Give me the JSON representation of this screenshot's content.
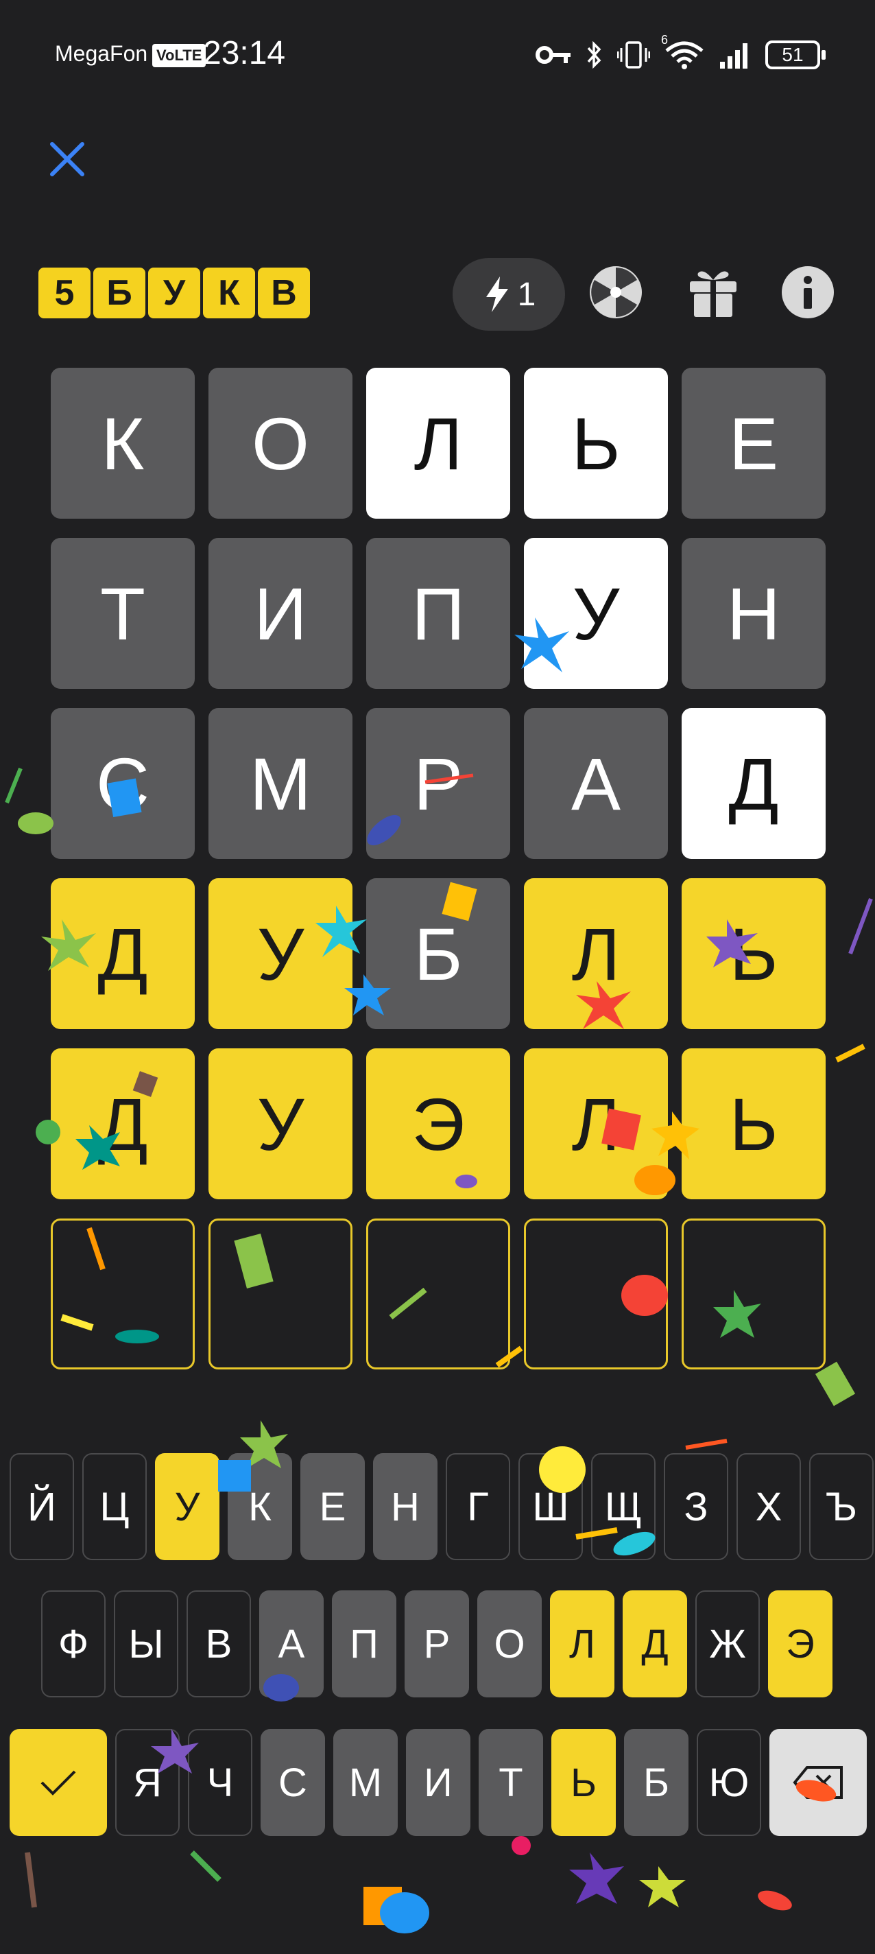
{
  "status_bar": {
    "carrier": "MegaFon",
    "volte": "VoLTE",
    "time": "23:14",
    "battery": "51",
    "network_sup": "6"
  },
  "header": {
    "word_length_badge": [
      "5",
      "Б",
      "У",
      "К",
      "В"
    ],
    "hint_count": "1",
    "icons": [
      "close-icon",
      "lightning-icon",
      "wheel-icon",
      "gift-icon",
      "info-icon"
    ]
  },
  "board": {
    "rows": [
      [
        {
          "l": "К",
          "s": "gray"
        },
        {
          "l": "О",
          "s": "gray"
        },
        {
          "l": "Л",
          "s": "white"
        },
        {
          "l": "Ь",
          "s": "white"
        },
        {
          "l": "Е",
          "s": "gray"
        }
      ],
      [
        {
          "l": "Т",
          "s": "gray"
        },
        {
          "l": "И",
          "s": "gray"
        },
        {
          "l": "П",
          "s": "gray"
        },
        {
          "l": "У",
          "s": "white"
        },
        {
          "l": "Н",
          "s": "gray"
        }
      ],
      [
        {
          "l": "С",
          "s": "gray"
        },
        {
          "l": "М",
          "s": "gray"
        },
        {
          "l": "Р",
          "s": "gray"
        },
        {
          "l": "А",
          "s": "gray"
        },
        {
          "l": "Д",
          "s": "white"
        }
      ],
      [
        {
          "l": "Д",
          "s": "yellow"
        },
        {
          "l": "У",
          "s": "yellow"
        },
        {
          "l": "Б",
          "s": "gray"
        },
        {
          "l": "Л",
          "s": "yellow"
        },
        {
          "l": "Ь",
          "s": "yellow"
        }
      ],
      [
        {
          "l": "Д",
          "s": "yellow"
        },
        {
          "l": "У",
          "s": "yellow"
        },
        {
          "l": "Э",
          "s": "yellow"
        },
        {
          "l": "Л",
          "s": "yellow"
        },
        {
          "l": "Ь",
          "s": "yellow"
        }
      ],
      [
        {
          "l": "",
          "s": "empty"
        },
        {
          "l": "",
          "s": "empty"
        },
        {
          "l": "",
          "s": "empty"
        },
        {
          "l": "",
          "s": "empty"
        },
        {
          "l": "",
          "s": "empty"
        }
      ]
    ]
  },
  "keyboard": {
    "row1": [
      {
        "k": "Й",
        "s": 0
      },
      {
        "k": "Ц",
        "s": 0
      },
      {
        "k": "У",
        "s": 2
      },
      {
        "k": "К",
        "s": 1
      },
      {
        "k": "Е",
        "s": 1
      },
      {
        "k": "Н",
        "s": 1
      },
      {
        "k": "Г",
        "s": 0
      },
      {
        "k": "Ш",
        "s": 0
      },
      {
        "k": "Щ",
        "s": 0
      },
      {
        "k": "З",
        "s": 0
      },
      {
        "k": "Х",
        "s": 0
      },
      {
        "k": "Ъ",
        "s": 0
      }
    ],
    "row2": [
      {
        "k": "Ф",
        "s": 0
      },
      {
        "k": "Ы",
        "s": 0
      },
      {
        "k": "В",
        "s": 0
      },
      {
        "k": "А",
        "s": 1
      },
      {
        "k": "П",
        "s": 1
      },
      {
        "k": "Р",
        "s": 1
      },
      {
        "k": "О",
        "s": 1
      },
      {
        "k": "Л",
        "s": 2
      },
      {
        "k": "Д",
        "s": 2
      },
      {
        "k": "Ж",
        "s": 0
      },
      {
        "k": "Э",
        "s": 2
      }
    ],
    "row3": [
      {
        "k": "Я",
        "s": 0
      },
      {
        "k": "Ч",
        "s": 0
      },
      {
        "k": "С",
        "s": 1
      },
      {
        "k": "М",
        "s": 1
      },
      {
        "k": "И",
        "s": 1
      },
      {
        "k": "Т",
        "s": 1
      },
      {
        "k": "Ь",
        "s": 2
      },
      {
        "k": "Б",
        "s": 1
      },
      {
        "k": "Ю",
        "s": 0
      }
    ]
  },
  "colors": {
    "background": "#1f1f21",
    "present": "#ffffff",
    "correct_yellow": "#f5d52a",
    "absent": "#5a5a5c",
    "close_icon": "#3b82f6"
  }
}
